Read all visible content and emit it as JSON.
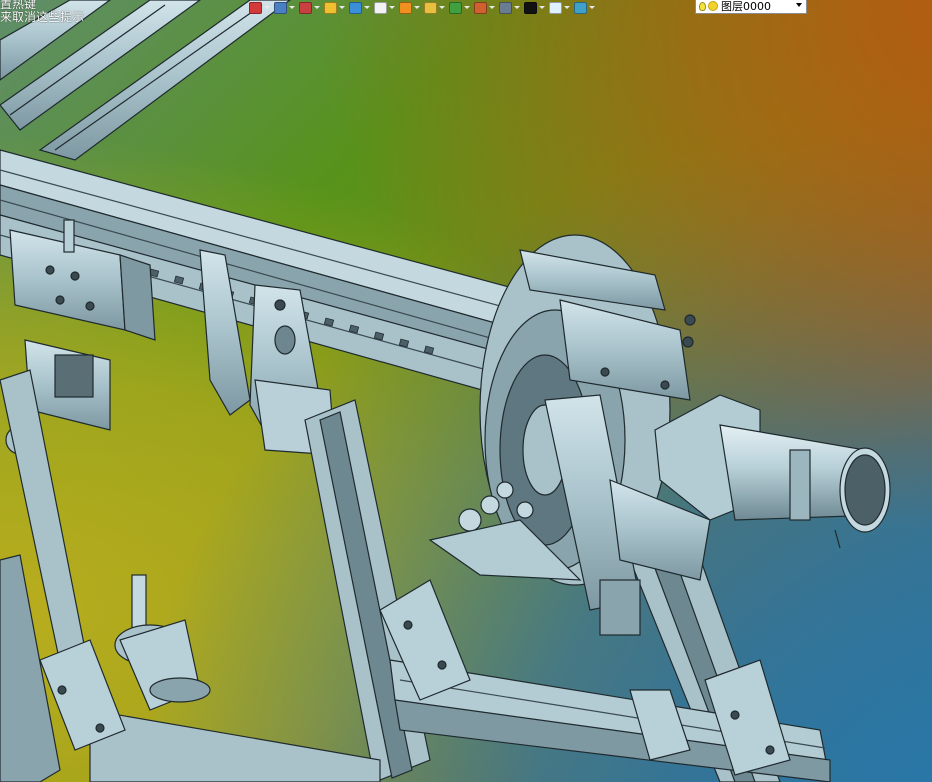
{
  "hints": {
    "line1": "置热键",
    "line2": "来取消这些提示"
  },
  "toolbar": {
    "buttons": [
      {
        "name": "pointer-icon",
        "color": "#d43a3a"
      },
      {
        "name": "view-orient-icon",
        "color": "#4b7fc4"
      },
      {
        "name": "sketch-pen-icon",
        "color": "#c94040"
      },
      {
        "name": "extrude-icon",
        "color": "#f0c030"
      },
      {
        "name": "solid-box-icon",
        "color": "#3a8fd8"
      },
      {
        "name": "white-box-icon",
        "color": "#f2f2f2"
      },
      {
        "name": "pattern-sphere-icon",
        "color": "#f09020"
      },
      {
        "name": "zoom-icon",
        "color": "#e8c040"
      },
      {
        "name": "refresh-icon",
        "color": "#40a040"
      },
      {
        "name": "section-view-icon",
        "color": "#d06030"
      },
      {
        "name": "display-style-icon",
        "color": "#6a7d90"
      },
      {
        "name": "line-style-icon",
        "color": "#111111"
      },
      {
        "name": "sheet-icon",
        "color": "#dff0ff"
      },
      {
        "name": "layer-stack-icon",
        "color": "#40a0c8"
      }
    ]
  },
  "layer": {
    "value": "图层0000"
  },
  "colors": {
    "steel": "#a9c4ce",
    "steel_dark": "#5e7780",
    "steel_light": "#d4e6ec",
    "edge": "#1f2a2e"
  }
}
